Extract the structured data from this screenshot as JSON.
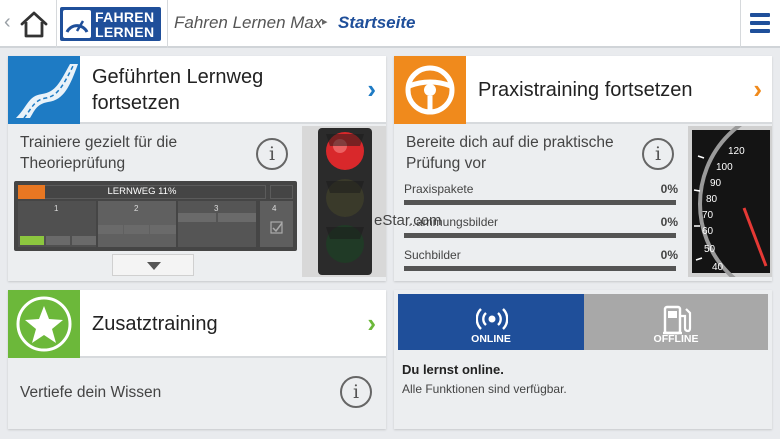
{
  "header": {
    "back_glyph": "‹",
    "logo_line1": "FAHREN",
    "logo_line2": "LERNEN",
    "user": "Fahren Lernen Max",
    "sep_glyph": "▸",
    "page": "Startseite",
    "brand_color": "#1f4f9a"
  },
  "cards": {
    "lernweg": {
      "title": "Geführten Lernweg fortsetzen",
      "text": "Trainiere gezielt für die Theorieprüfung",
      "icon": "road-icon",
      "accent": "#1e7bc4",
      "arrow": "›",
      "progress_label": "LERNWEG 11%",
      "progress_value": 0.11,
      "columns": [
        "1",
        "2",
        "3",
        "4"
      ],
      "image": "traffic-light-icon"
    },
    "praxis": {
      "title": "Praxistraining fortsetzen",
      "text": "Bereite dich auf die praktische Prüfung vor",
      "icon": "steering-wheel-icon",
      "accent": "#f08a1c",
      "arrow": "›",
      "image": "speedometer-icon",
      "rows": [
        {
          "label": "Praxispakete",
          "pct": "0%",
          "value": 0
        },
        {
          "label": "…ammungsbilder",
          "pct": "0%",
          "value": 0
        },
        {
          "label": "Suchbilder",
          "pct": "0%",
          "value": 0
        }
      ]
    },
    "zusatz": {
      "title": "Zusatztraining",
      "text": "Vertiefe dein Wissen",
      "icon": "star-icon",
      "accent": "#6cb83a",
      "arrow": "›"
    }
  },
  "mode": {
    "online_label": "ONLINE",
    "offline_label": "OFFLINE",
    "status_title": "Du lernst online.",
    "status_desc": "Alle Funktionen sind verfügbar.",
    "online_color": "#1f4f9a",
    "offline_color": "#a8a8a8"
  },
  "info_glyph": "i",
  "watermark": "eStar.com"
}
